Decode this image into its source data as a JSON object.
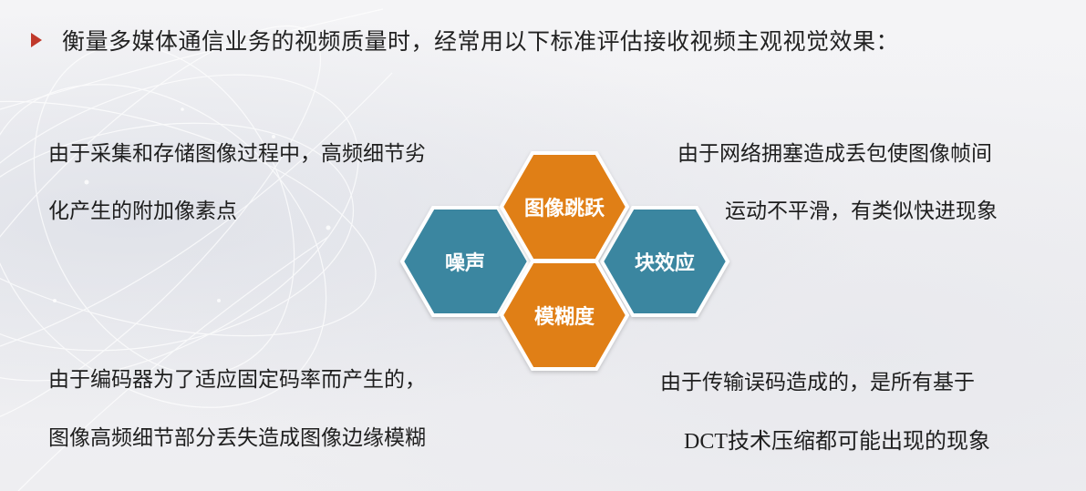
{
  "title": "衡量多媒体通信业务的视频质量时，经常用以下标准评估接收视频主观视觉效果：",
  "colors": {
    "orange": "#e07f16",
    "teal": "#3a86a0",
    "bullet": "#c0392b"
  },
  "hexagons": {
    "image_jump": "图像跳跃",
    "noise": "噪声",
    "block_effect": "块效应",
    "blur": "模糊度"
  },
  "descriptions": {
    "noise_line1": "由于采集和存储图像过程中，高频细节劣",
    "noise_line2": "化产生的附加像素点",
    "jump_line1": "由于网络拥塞造成丢包使图像帧间",
    "jump_line2": "运动不平滑，有类似快进现象",
    "blur_line1": "由于编码器为了适应固定码率而产生的，",
    "blur_line2": "图像高频细节部分丢失造成图像边缘模糊",
    "block_line1": "由于传输误码造成的，是所有基于",
    "block_line2": "DCT技术压缩都可能出现的现象"
  }
}
